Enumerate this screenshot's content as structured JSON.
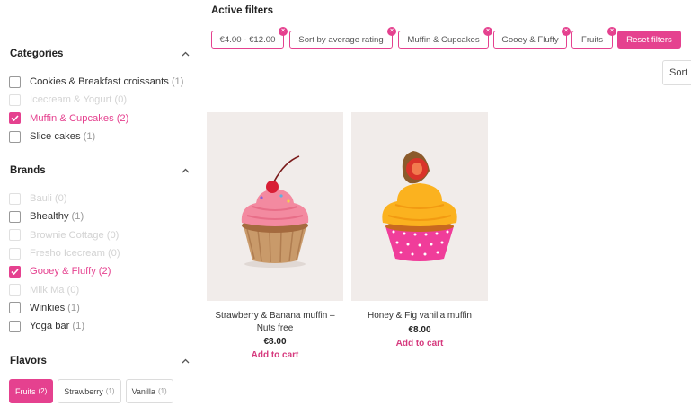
{
  "sidebar": {
    "categories": {
      "title": "Categories",
      "items": [
        {
          "label": "Cookies & Breakfast croissants",
          "count": "(1)",
          "state": "normal"
        },
        {
          "label": "Icecream & Yogurt",
          "count": "(0)",
          "state": "disabled"
        },
        {
          "label": "Muffin & Cupcakes",
          "count": "(2)",
          "state": "checked"
        },
        {
          "label": "Slice cakes",
          "count": "(1)",
          "state": "normal"
        }
      ]
    },
    "brands": {
      "title": "Brands",
      "items": [
        {
          "label": "Bauli",
          "count": "(0)",
          "state": "disabled"
        },
        {
          "label": "Bhealthy",
          "count": "(1)",
          "state": "normal"
        },
        {
          "label": "Brownie Cottage",
          "count": "(0)",
          "state": "disabled"
        },
        {
          "label": "Fresho Icecream",
          "count": "(0)",
          "state": "disabled"
        },
        {
          "label": "Gooey & Fluffy",
          "count": "(2)",
          "state": "checked"
        },
        {
          "label": "Milk Ma",
          "count": "(0)",
          "state": "disabled"
        },
        {
          "label": "Winkies",
          "count": "(1)",
          "state": "normal"
        },
        {
          "label": "Yoga bar",
          "count": "(1)",
          "state": "normal"
        }
      ]
    },
    "flavors": {
      "title": "Flavors",
      "items": [
        {
          "label": "Fruits",
          "count": "(2)",
          "active": true
        },
        {
          "label": "Strawberry",
          "count": "(1)",
          "active": false
        },
        {
          "label": "Vanilla",
          "count": "(1)",
          "active": false
        }
      ]
    }
  },
  "active_filters": {
    "title": "Active filters",
    "chips": [
      "€4.00 - €12.00",
      "Sort by average rating",
      "Muffin & Cupcakes",
      "Gooey & Fluffy",
      "Fruits"
    ],
    "reset_label": "Reset filters"
  },
  "sort": {
    "label": "Sort"
  },
  "products": [
    {
      "name": "Strawberry & Banana muffin – Nuts free",
      "price": "€8.00",
      "cta": "Add to cart",
      "image": "pink-frosting-cupcake"
    },
    {
      "name": "Honey & Fig vanilla muffin",
      "price": "€8.00",
      "cta": "Add to cart",
      "image": "orange-frosting-fig-cupcake"
    }
  ],
  "colors": {
    "accent": "#e5418f",
    "image_bg": "#f1ecea"
  }
}
